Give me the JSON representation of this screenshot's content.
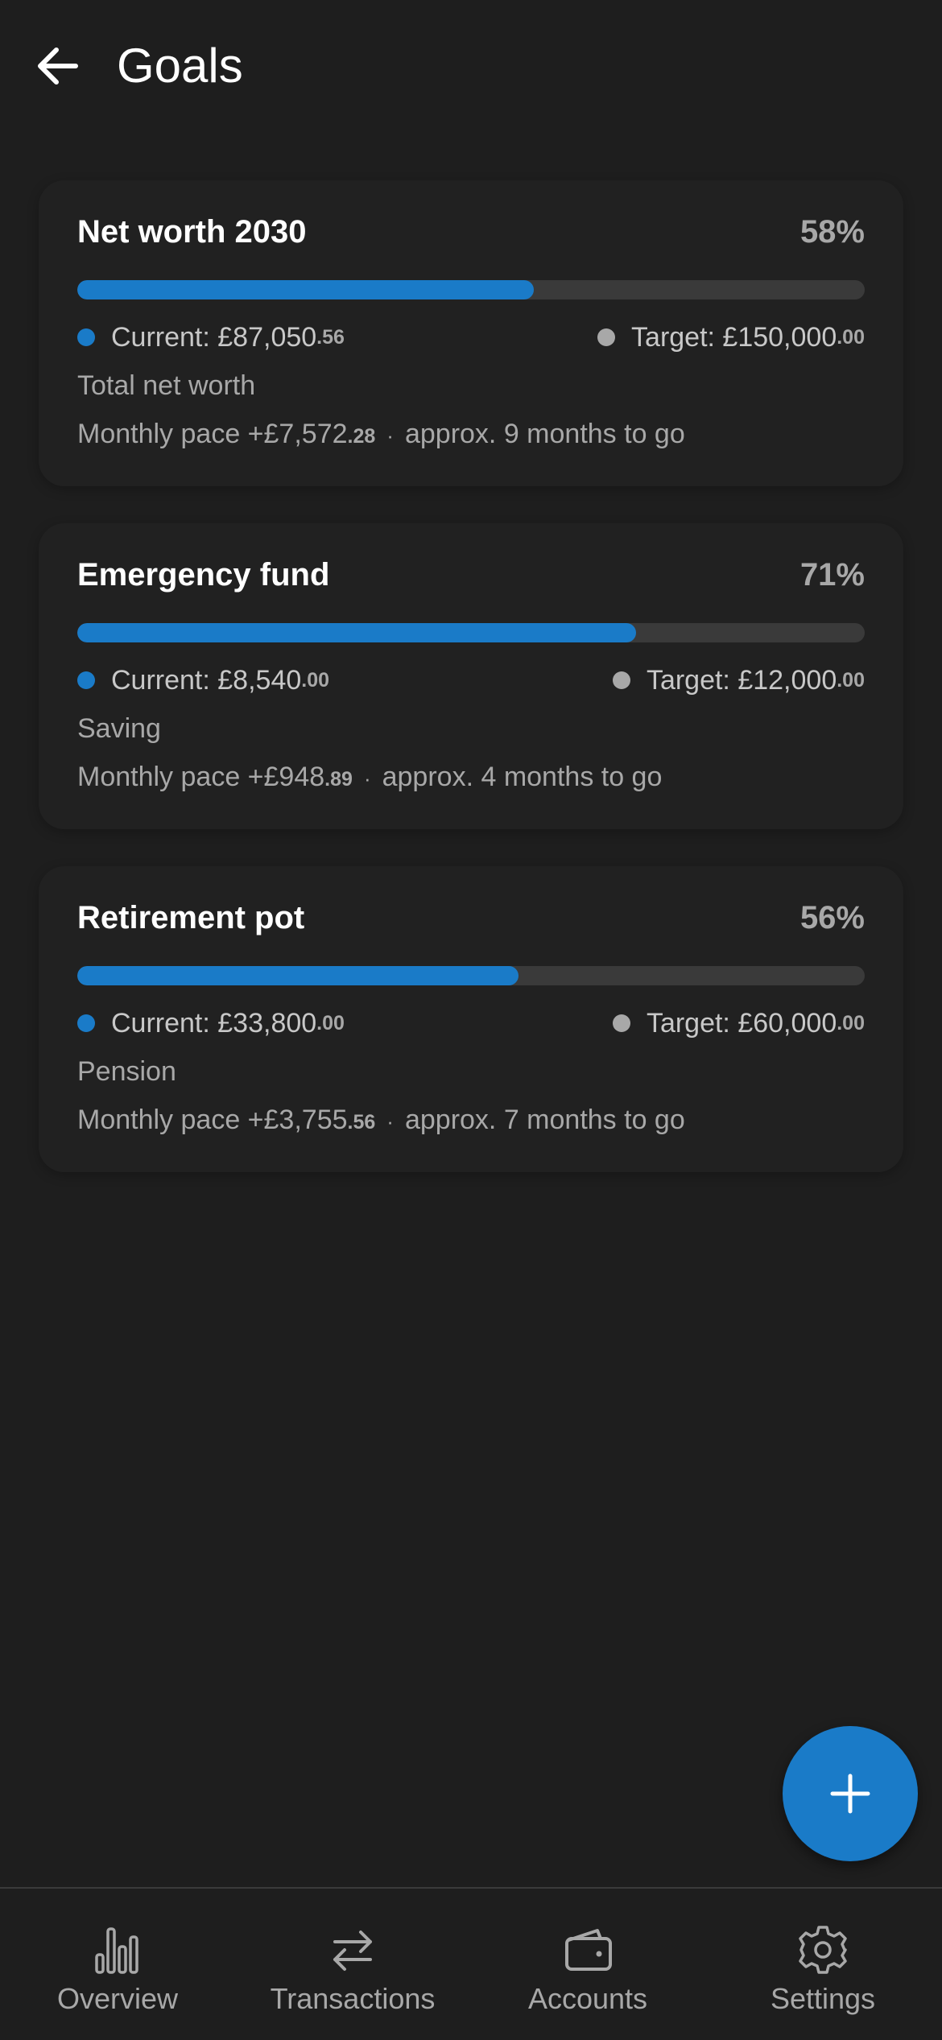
{
  "appbar": {
    "title": "Goals",
    "back_icon": "arrow-left-icon"
  },
  "goals": [
    {
      "title": "Net worth 2030",
      "percent_label": "58%",
      "progress": 0.58,
      "current_label": "Current: £87,050",
      "current_decimals": ".56",
      "target_label": "Target: £150,000",
      "target_decimals": ".00",
      "category": "Total net worth",
      "pace_label": "Monthly pace +£7,572",
      "pace_decimals": ".28",
      "separator": "·",
      "eta": "approx. 9 months to go"
    },
    {
      "title": "Emergency fund",
      "percent_label": "71%",
      "progress": 0.71,
      "current_label": "Current: £8,540",
      "current_decimals": ".00",
      "target_label": "Target: £12,000",
      "target_decimals": ".00",
      "category": "Saving",
      "pace_label": "Monthly pace +£948",
      "pace_decimals": ".89",
      "separator": "·",
      "eta": "approx. 4 months to go"
    },
    {
      "title": "Retirement pot",
      "percent_label": "56%",
      "progress": 0.56,
      "current_label": "Current: £33,800",
      "current_decimals": ".00",
      "target_label": "Target: £60,000",
      "target_decimals": ".00",
      "category": "Pension",
      "pace_label": "Monthly pace +£3,755",
      "pace_decimals": ".56",
      "separator": "·",
      "eta": "approx. 7 months to go"
    }
  ],
  "fab": {
    "icon": "plus-icon"
  },
  "bottom_nav": [
    {
      "label": "Overview",
      "icon": "bar-chart-icon"
    },
    {
      "label": "Transactions",
      "icon": "swap-arrows-icon"
    },
    {
      "label": "Accounts",
      "icon": "wallet-icon"
    },
    {
      "label": "Settings",
      "icon": "gear-icon"
    }
  ],
  "colors": {
    "background": "#1e1e1e",
    "card": "#212121",
    "accent": "#1a7bc8",
    "track": "#3a3a3a",
    "muted_text": "#a8a8a8"
  }
}
